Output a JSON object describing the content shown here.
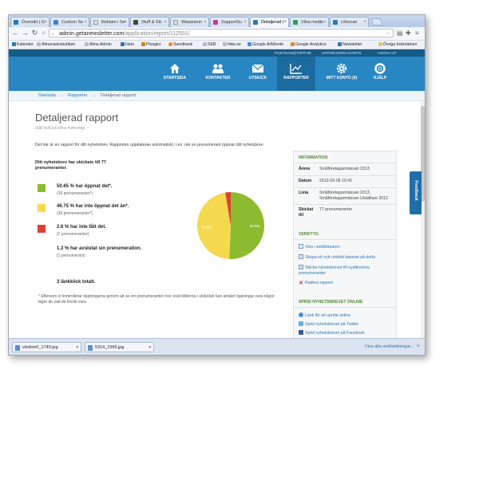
{
  "browser": {
    "tabs": [
      {
        "label": "Översikt | G",
        "color": "#2d77b4",
        "active": false
      },
      {
        "label": "Custom Se",
        "color": "#3b82d6",
        "active": false
      },
      {
        "label": "Reklam i Se",
        "color": "#f0f0f0",
        "active": false
      },
      {
        "label": "Stuff & Ski",
        "color": "#444444",
        "active": false
      },
      {
        "label": "Wasaneon",
        "color": "#f0f0f0",
        "active": false
      },
      {
        "label": "SupportSu",
        "color": "#c03a9b",
        "active": false
      },
      {
        "label": "Detaljerad r",
        "color": "#2d77b4",
        "active": true
      },
      {
        "label": "Våra medle",
        "color": "#2fa05a",
        "active": false
      },
      {
        "label": "Lifescan",
        "color": "#2d77b4",
        "active": false
      }
    ],
    "url_host": "admin.getanewsletter.com",
    "url_path": "/application/report/112551/",
    "bookmarks": [
      "Kalender",
      "Almanacksbutiken",
      "Alma Admin",
      "Hem",
      "Plusgiro",
      "Swedbank",
      "SEB",
      "hitta.se",
      "Google AdWords",
      "Google Analytics",
      "Newsletter",
      "Övriga bokmärken"
    ]
  },
  "site": {
    "top_links": [
      "PCBYRAN@TOPP.SE",
      "UPPGRADERA KONTO",
      "LOGGA UT"
    ],
    "nav": [
      {
        "label": "STARTSIDA",
        "icon": "home-icon"
      },
      {
        "label": "KONTAKTER",
        "icon": "contacts-icon"
      },
      {
        "label": "UTSKICK",
        "icon": "envelope-icon"
      },
      {
        "label": "RAPPORTER",
        "icon": "chart-icon"
      },
      {
        "label": "MITT KONTO (0)",
        "icon": "gear-icon"
      },
      {
        "label": "HJÄLP",
        "icon": "lifebuoy-icon"
      }
    ],
    "breadcrumb": [
      "Startsida",
      "Rapporter",
      "Detaljerad rapport"
    ]
  },
  "report": {
    "title": "Detaljerad rapport",
    "subtitle": "Håll koll på dina framsteg.",
    "intro": "Det här är en rapport för ditt nyhetsbrev. Rapporten uppdateras automatiskt, t.ex. när en prenumerant öppnar ditt nyhetsbrev.",
    "sent_title": "Ditt nyhetsbrev har skickats till 77 prenumeranter.",
    "stats": [
      {
        "main": "50.65 % har öppnat det*.",
        "sub": "(39 prenumeranter*)",
        "color": "#8dbb2f"
      },
      {
        "main": "46.75 % har inte öppnat det än*.",
        "sub": "(36 prenumeranter*)",
        "color": "#f5d94f"
      },
      {
        "main": "2.6 % har inte fått det.",
        "sub": "(2 prenumeranter)",
        "color": "#e0403a"
      },
      {
        "main": "1.3 % har avslutat sin prenumeration.",
        "sub": "(1 prenumerant)",
        "color": ""
      }
    ],
    "clicks": "3 länkklick totalt.",
    "footnote": "* Eftersom vi kontrollerar öppningarna genom att se om prenumeranten har visat bilderna i utskicket kan antalet öppningar vara något lägre än vad de borde vara."
  },
  "chart_data": {
    "type": "pie",
    "labels": [
      "Öppnat",
      "Inte öppnat",
      "Inte fått"
    ],
    "values": [
      50.65,
      46.75,
      2.6
    ],
    "slice_labels": [
      "50.6%",
      "46.8%",
      ""
    ],
    "colors": [
      "#8dbb2f",
      "#f5d94f",
      "#e0403a"
    ]
  },
  "sidebar": {
    "info_title": "INFORMATION",
    "info": [
      {
        "key": "Ämne",
        "value": "Småföretagarmässan 2013"
      },
      {
        "key": "Datum",
        "value": "2013-03-08 10:42"
      },
      {
        "key": "Lista",
        "value": "Småföretagarmässan 2013, Småföretagarmässan Utställare 2012"
      },
      {
        "key": "Skickat till",
        "value": "77 prenumeranter"
      }
    ],
    "tools_title": "VERKTYG",
    "tools": [
      {
        "label": "Visa i webbläsaren",
        "icon": "browser-icon"
      },
      {
        "label": "Skapa ett nytt utskick baserat på detta",
        "icon": "new-mail-icon"
      },
      {
        "label": "Skicka nyhetsbrevet till nyafikomna prenumeranter",
        "icon": "send-icon"
      },
      {
        "label": "Radera rapport",
        "icon": "delete-icon"
      }
    ],
    "spread_title": "SPRID NYHETSBREVET ONLINE",
    "spread": [
      {
        "label": "Länk för att sprida online",
        "icon": "link-icon"
      },
      {
        "label": "Sprid nyhetsbrevet på Twitter",
        "icon": "twitter-icon"
      },
      {
        "label": "Sprid nyhetsbrevet på Facebook",
        "icon": "facebook-icon"
      }
    ],
    "feedback": "Feedback"
  },
  "downloads": {
    "items": [
      "visdom0_1749.jpg",
      "5314_1566.jpg"
    ],
    "show_all": "Visa alla nedladdningar..."
  }
}
